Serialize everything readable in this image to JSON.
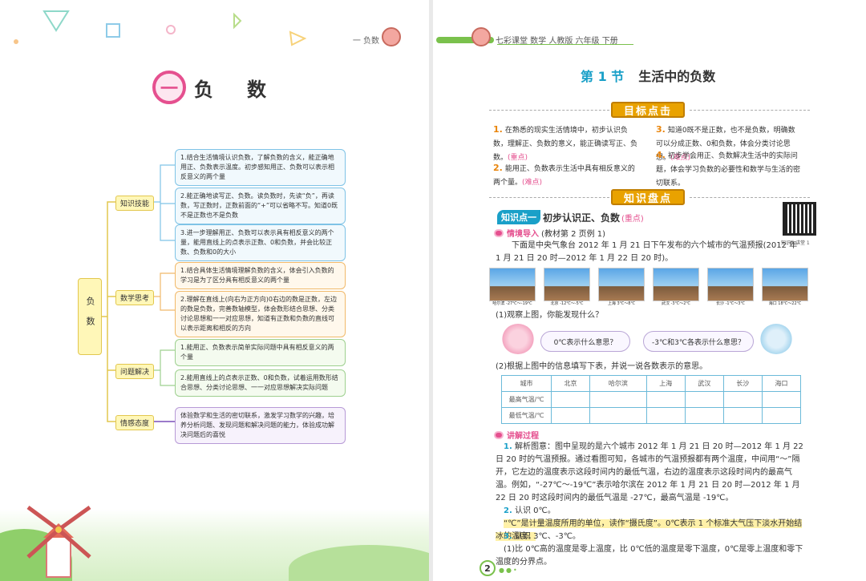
{
  "left": {
    "header": "一  负数",
    "chapter": {
      "num": "一",
      "title": "负数"
    },
    "map": {
      "root": "负数",
      "branches": [
        {
          "label": "知识技能",
          "items": [
            "1.结合生活情境认识负数，了解负数的含义，能正确地用正、负数表示温度。初步感知用正、负数可以表示相反意义的两个量",
            "2.能正确地读写正、负数。读负数时，先读“负”，再读数，写正数时，正数前面的“+”可以省略不写。知道0既不是正数也不是负数",
            "3.进一步理解用正、负数可以表示具有相反意义的两个量，能用直线上的点表示正数、0和负数，并会比较正数、负数和0的大小"
          ]
        },
        {
          "label": "数学思考",
          "items": [
            "1.结合具体生活情境理解负数的含义，体会引入负数的学习是为了区分具有相反意义的两个量",
            "2.理解在直线上(向右为正方向)0右边的数是正数，左边的数是负数，完善数轴模型，体会数形结合思想、分类讨论思想和一一对应思想，知道有正数和负数的直线可以表示距离和相反的方向"
          ]
        },
        {
          "label": "问题解决",
          "items": [
            "1.能用正、负数表示简单实际问题中具有相反意义的两个量",
            "2.能用直线上的点表示正数、0和负数，试着运用数形结合思想、分类讨论思想、一一对应思想解决实际问题"
          ]
        },
        {
          "label": "情感态度",
          "items": [
            "体验数学和生活的密切联系，激发学习数学的兴趣，培养分析问题、发现问题和解决问题的能力，体验成功解决问题后的喜悦"
          ]
        }
      ]
    }
  },
  "right": {
    "header": "七彩课堂  数学  人教版  六年级  下册",
    "section": {
      "num": "第 1 节",
      "name": "生活中的负数"
    },
    "goals_banner": "目标点击",
    "goals": [
      {
        "n": "1.",
        "text": "在熟悉的现实生活情境中，初步认识负数，理解正、负数的意义，能正确读写正、负数。",
        "tag": "(重点)"
      },
      {
        "n": "2.",
        "text": "能用正、负数表示生活中具有相反意义的两个量。",
        "tag": "(难点)"
      },
      {
        "n": "3.",
        "text": "知道0既不是正数，也不是负数，明确数可以分成正数、0和负数，体会分类讨论思想。",
        "tag": "(难点)"
      },
      {
        "n": "4.",
        "text": "初步学会用正、负数解决生活中的实际问题，体会学习负数的必要性和数学与生活的密切联系。",
        "tag": ""
      }
    ],
    "knowledge_banner": "知识盘点",
    "kp": {
      "tag": "知识点一",
      "title": "初步认识正、负数",
      "emph": "(重点)"
    },
    "qr_caption": "知识大讲堂 1",
    "intro_head": {
      "label": "情境导入",
      "ref": "(教材第 2 页例 1)"
    },
    "intro_text": "下面是中央气象台 2012 年 1 月 21 日下午发布的六个城市的气温预报(2012 年 1 月 21 日 20 时—2012 年 1 月 22 日 20 时)。",
    "photos": [
      {
        "cap": "哈尔滨  -27℃～-19℃"
      },
      {
        "cap": "北京  -12℃～-5℃"
      },
      {
        "cap": "上海  3℃～8℃"
      },
      {
        "cap": "武汉  -3℃～2℃"
      },
      {
        "cap": "长沙  -1℃～3℃"
      },
      {
        "cap": "海口  18℃～22℃"
      }
    ],
    "q1": "(1)观察上图，你能发现什么？",
    "bubbles": [
      "0℃表示什么意思？",
      "-3℃和3℃各表示什么意思？"
    ],
    "q2": "(2)根据上图中的信息填写下表，并说一说各数表示的意思。",
    "table": {
      "header": [
        "城市",
        "北京",
        "哈尔滨",
        "上海",
        "武汉",
        "长沙",
        "海口"
      ],
      "rows": [
        "最高气温/℃",
        "最低气温/℃"
      ]
    },
    "explain_head": "讲解过程",
    "explain": [
      {
        "n": "1.",
        "text": "解析图意：图中呈现的是六个城市 2012 年 1 月 21 日 20 时—2012 年 1 月 22 日 20 时的气温预报。通过看图可知，各城市的气温预报都有两个温度，中间用“～”隔开，它左边的温度表示这段时间内的最低气温，右边的温度表示这段时间内的最高气温。例如，“-27℃～-19℃”表示哈尔滨在 2012 年 1 月 21 日 20 时—2012 年 1 月 22 日 20 时这段时间内的最低气温是 -27℃，最高气温是 -19℃。"
      },
      {
        "n": "2.",
        "text": "认识 0℃。"
      },
      {
        "n": "",
        "text": "“℃”是计量温度所用的单位，读作“摄氏度”。0℃表示 1 个标准大气压下淡水开始结冰的温度。"
      },
      {
        "n": "3.",
        "text": "认识 3℃、-3℃。"
      },
      {
        "n": "",
        "text": "(1)比 0℃高的温度是零上温度，比 0℃低的温度是零下温度，0℃是零上温度和零下温度的分界点。"
      }
    ],
    "page_num": "2"
  }
}
